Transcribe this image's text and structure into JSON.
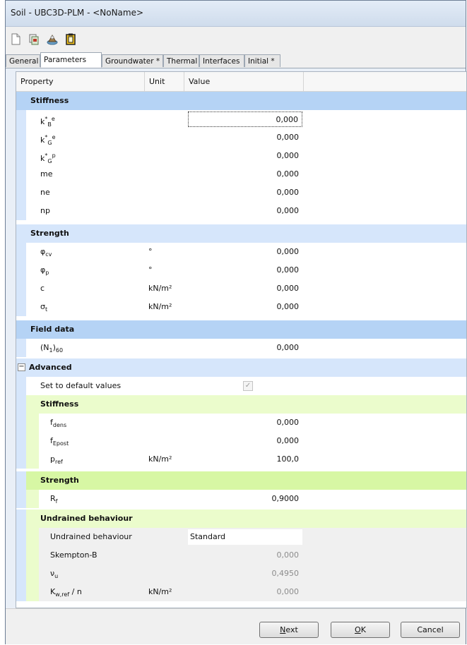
{
  "window": {
    "title": "Soil - UBC3D-PLM - <NoName>"
  },
  "toolbar": {
    "icons": [
      "new-document-icon",
      "copy-icon",
      "database-icon",
      "clipboard-icon"
    ]
  },
  "tabs": [
    {
      "label": "General"
    },
    {
      "label": "Parameters",
      "active": true
    },
    {
      "label": "Groundwater *"
    },
    {
      "label": "Thermal"
    },
    {
      "label": "Interfaces"
    },
    {
      "label": "Initial *"
    }
  ],
  "grid": {
    "columns": [
      "Property",
      "Unit",
      "Value"
    ]
  },
  "stiffness": {
    "title": "Stiffness",
    "kBe": {
      "base": "k",
      "sup": "*",
      "sub": "B",
      "sup2": "e",
      "value": "0,000"
    },
    "kGe": {
      "base": "k",
      "sup": "*",
      "sub": "G",
      "sup2": "e",
      "value": "0,000"
    },
    "kGp": {
      "base": "k",
      "sup": "*",
      "sub": "G",
      "sup2": "p",
      "value": "0,000"
    },
    "me": {
      "label": "me",
      "value": "0,000"
    },
    "ne": {
      "label": "ne",
      "value": "0,000"
    },
    "np": {
      "label": "np",
      "value": "0,000"
    }
  },
  "strength": {
    "title": "Strength",
    "phicv": {
      "base": "φ",
      "sub": "cv",
      "unit": "°",
      "value": "0,000"
    },
    "phip": {
      "base": "φ",
      "sub": "p",
      "unit": "°",
      "value": "0,000"
    },
    "c": {
      "label": "c",
      "unit": "kN/m²",
      "value": "0,000"
    },
    "sigt": {
      "base": "σ",
      "sub": "t",
      "unit": "kN/m²",
      "value": "0,000"
    }
  },
  "field": {
    "title": "Field data",
    "n160": {
      "base": "(N",
      "sub": "1",
      "base2": ")",
      "sub2": "60",
      "value": "0,000"
    }
  },
  "advanced": {
    "title": "Advanced",
    "collapse": "−",
    "default_label": "Set to default values",
    "default_check": "✓",
    "stiffness": {
      "title": "Stiffness",
      "fdens": {
        "base": "f",
        "sub": "dens",
        "value": "0,000"
      },
      "fepost": {
        "base": "f",
        "sub": "Epost",
        "value": "0,000"
      },
      "pref": {
        "base": "p",
        "sub": "ref",
        "unit": "kN/m²",
        "value": "100,0"
      }
    },
    "strength": {
      "title": "Strength",
      "rf": {
        "base": "R",
        "sub": "f",
        "value": "0,9000"
      }
    },
    "undrained": {
      "title": "Undrained behaviour",
      "behaviour": {
        "label": "Undrained behaviour",
        "value": "Standard"
      },
      "skempton": {
        "label": "Skempton-B",
        "value": "0,000"
      },
      "nuu": {
        "base": "ν",
        "sub": "u",
        "value": "0,4950"
      },
      "kw": {
        "base": "K",
        "sub": "w,ref",
        "base2": " / n",
        "unit": "kN/m²",
        "value": "0,000"
      }
    }
  },
  "buttons": {
    "next": {
      "mnemonic": "N",
      "rest": "ext"
    },
    "ok": {
      "mnemonic": "O",
      "rest": "K"
    },
    "cancel": {
      "label": "Cancel"
    }
  }
}
